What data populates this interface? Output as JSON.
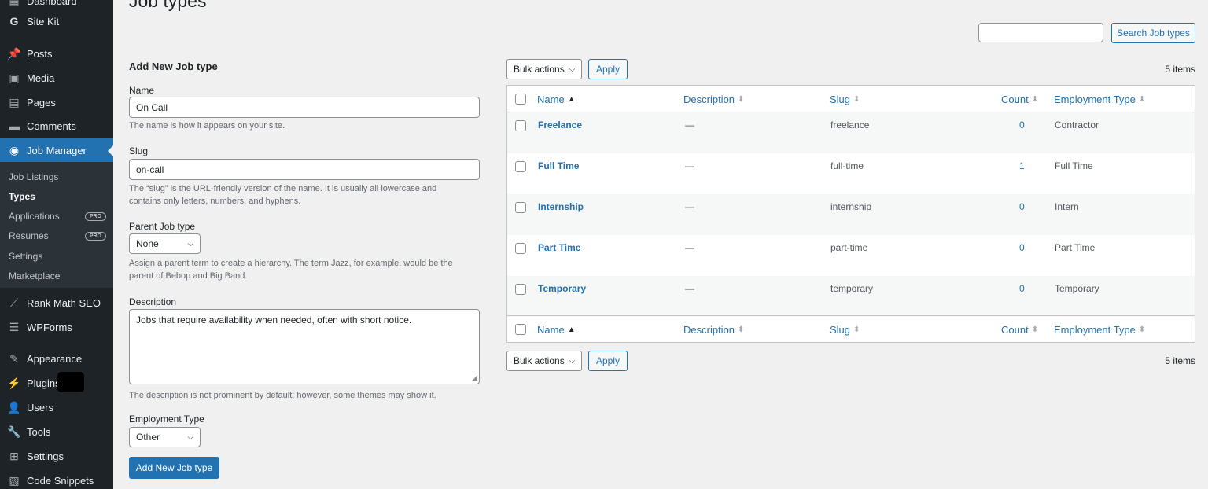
{
  "sidebar": {
    "items": [
      {
        "label": "Dashboard",
        "icon": "dashboard-icon"
      },
      {
        "label": "Site Kit",
        "icon": "site-kit-g-icon"
      },
      {
        "label": "Posts",
        "icon": "pin-icon"
      },
      {
        "label": "Media",
        "icon": "media-icon"
      },
      {
        "label": "Pages",
        "icon": "pages-icon"
      },
      {
        "label": "Comments",
        "icon": "comment-icon"
      },
      {
        "label": "Job Manager",
        "icon": "job-manager-icon"
      },
      {
        "label": "Rank Math SEO",
        "icon": "rank-math-icon"
      },
      {
        "label": "WPForms",
        "icon": "wpforms-icon"
      },
      {
        "label": "Appearance",
        "icon": "brush-icon"
      },
      {
        "label": "Plugins",
        "icon": "plugin-icon"
      },
      {
        "label": "Users",
        "icon": "user-icon"
      },
      {
        "label": "Tools",
        "icon": "wrench-icon"
      },
      {
        "label": "Settings",
        "icon": "settings-icon"
      },
      {
        "label": "Code Snippets",
        "icon": "code-icon"
      }
    ],
    "submenu": [
      {
        "label": "Job Listings"
      },
      {
        "label": "Types"
      },
      {
        "label": "Applications",
        "badge": "PRO"
      },
      {
        "label": "Resumes",
        "badge": "PRO"
      },
      {
        "label": "Settings"
      },
      {
        "label": "Marketplace"
      }
    ]
  },
  "page": {
    "title": "Job types",
    "search_button": "Search Job types",
    "search_value": ""
  },
  "form": {
    "heading": "Add New Job type",
    "name_label": "Name",
    "name_value": "On Call",
    "name_help": "The name is how it appears on your site.",
    "slug_label": "Slug",
    "slug_value": "on-call",
    "slug_help_1": "The “slug” is the URL-friendly version of the name. It is usually all lowercase and",
    "slug_help_2": "contains only letters, numbers, and hyphens.",
    "parent_label": "Parent Job type",
    "parent_value": "None",
    "parent_help_1": "Assign a parent term to create a hierarchy. The term Jazz, for example, would be the",
    "parent_help_2": "parent of Bebop and Big Band.",
    "description_label": "Description",
    "description_value": "Jobs that require availability when needed, often with short notice.",
    "description_help": "The description is not prominent by default; however, some themes may show it.",
    "employment_label": "Employment Type",
    "employment_value": "Other",
    "submit_label": "Add New Job type"
  },
  "table": {
    "bulk_label": "Bulk actions",
    "apply_label": "Apply",
    "items_count": "5 items",
    "columns": {
      "name": "Name",
      "description": "Description",
      "slug": "Slug",
      "count": "Count",
      "employment_type": "Employment Type"
    },
    "rows": [
      {
        "name": "Freelance",
        "description": "—",
        "slug": "freelance",
        "count": "0",
        "employment_type": "Contractor"
      },
      {
        "name": "Full Time",
        "description": "—",
        "slug": "full-time",
        "count": "1",
        "employment_type": "Full Time"
      },
      {
        "name": "Internship",
        "description": "—",
        "slug": "internship",
        "count": "0",
        "employment_type": "Intern"
      },
      {
        "name": "Part Time",
        "description": "—",
        "slug": "part-time",
        "count": "0",
        "employment_type": "Part Time"
      },
      {
        "name": "Temporary",
        "description": "—",
        "slug": "temporary",
        "count": "0",
        "employment_type": "Temporary"
      }
    ]
  },
  "colors": {
    "sidebar_bg": "#1d2327",
    "accent": "#2271b1",
    "page_bg": "#f0f0f1"
  }
}
